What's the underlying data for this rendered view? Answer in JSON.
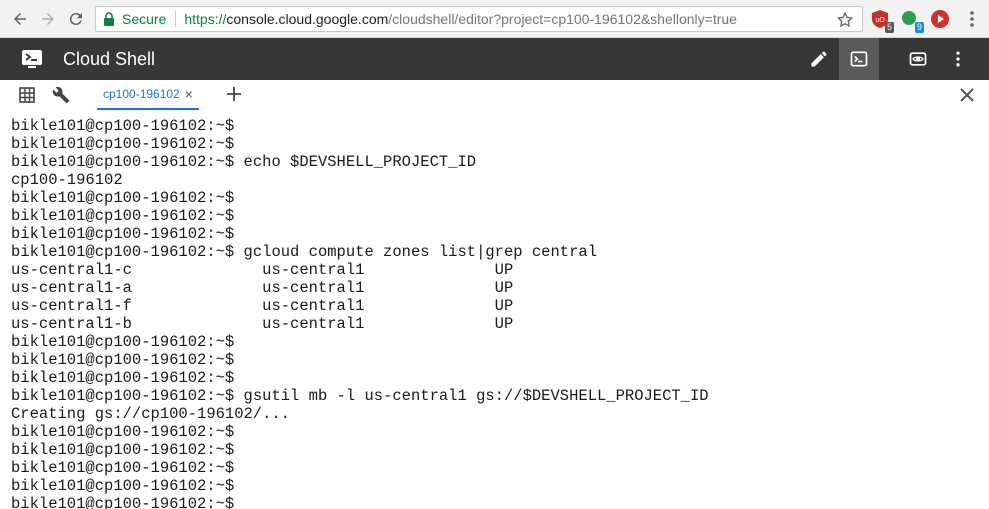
{
  "browser": {
    "secure_label": "Secure",
    "url_scheme": "https://",
    "url_host": "console.cloud.google.com",
    "url_rest": "/cloudshell/editor?project=cp100-196102&shellonly=true",
    "extensions": [
      {
        "icon": "ublock-icon",
        "badge": "5",
        "color": "#c4302b"
      },
      {
        "icon": "green-dot-extension-icon",
        "badge": "9",
        "color": "#2e9e4e"
      },
      {
        "icon": "play-extension-icon",
        "badge": "",
        "color": "#d32f2f"
      }
    ]
  },
  "header": {
    "title": "Cloud Shell"
  },
  "tabs": {
    "items": [
      {
        "label": "cp100-196102",
        "close": "×"
      }
    ],
    "add_label": "+"
  },
  "terminal": {
    "lines": [
      "bikle101@cp100-196102:~$",
      "bikle101@cp100-196102:~$",
      "bikle101@cp100-196102:~$ echo $DEVSHELL_PROJECT_ID",
      "cp100-196102",
      "bikle101@cp100-196102:~$",
      "bikle101@cp100-196102:~$",
      "bikle101@cp100-196102:~$",
      "bikle101@cp100-196102:~$ gcloud compute zones list|grep central",
      "us-central1-c              us-central1              UP",
      "us-central1-a              us-central1              UP",
      "us-central1-f              us-central1              UP",
      "us-central1-b              us-central1              UP",
      "bikle101@cp100-196102:~$",
      "bikle101@cp100-196102:~$",
      "bikle101@cp100-196102:~$",
      "bikle101@cp100-196102:~$ gsutil mb -l us-central1 gs://$DEVSHELL_PROJECT_ID",
      "Creating gs://cp100-196102/...",
      "bikle101@cp100-196102:~$",
      "bikle101@cp100-196102:~$",
      "bikle101@cp100-196102:~$",
      "bikle101@cp100-196102:~$",
      "bikle101@cp100-196102:~$"
    ]
  },
  "colors": {
    "header_bg": "#373737",
    "accent": "#1a73e8",
    "secure_green": "#0b8043"
  }
}
